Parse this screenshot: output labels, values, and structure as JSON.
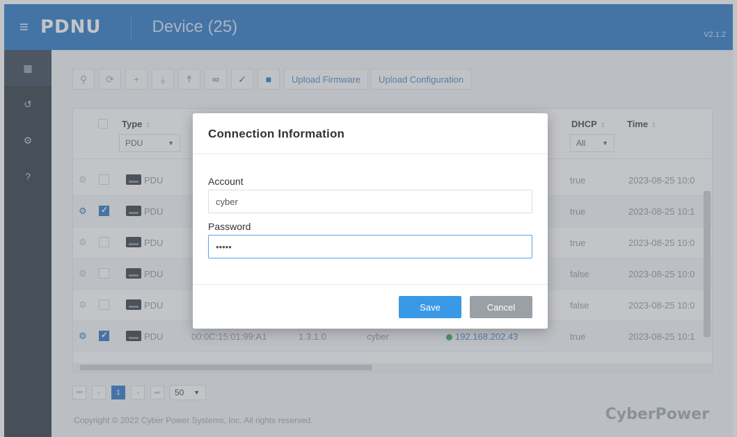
{
  "header": {
    "brand": "PDNU",
    "title": "Device (25)",
    "version": "V2.1.2"
  },
  "sidebar": {
    "items": [
      "grid-icon",
      "history-icon",
      "gear-icon",
      "help-icon"
    ]
  },
  "toolbar": {
    "icons": [
      "search-icon",
      "refresh-icon",
      "add-icon",
      "download-icon",
      "upload-icon",
      "link-icon",
      "check-icon",
      "delete-icon"
    ],
    "upload_firmware": "Upload Firmware",
    "upload_configuration": "Upload Configuration"
  },
  "table": {
    "columns": {
      "type": "Type",
      "dhcp": "DHCP",
      "time": "Time"
    },
    "filters": {
      "type": "PDU",
      "dhcp": "All"
    },
    "rows": [
      {
        "selected": false,
        "type": "PDU",
        "mac": "",
        "fw": "",
        "account": "",
        "ip": "",
        "dhcp": "true",
        "time": "2023-08-25 10:0"
      },
      {
        "selected": true,
        "type": "PDU",
        "mac": "",
        "fw": "",
        "account": "",
        "ip": "",
        "dhcp": "true",
        "time": "2023-08-25 10:1"
      },
      {
        "selected": false,
        "type": "PDU",
        "mac": "",
        "fw": "",
        "account": "",
        "ip": "",
        "dhcp": "true",
        "time": "2023-08-25 10:0"
      },
      {
        "selected": false,
        "type": "PDU",
        "mac": "",
        "fw": "",
        "account": "",
        "ip": "",
        "dhcp": "false",
        "time": "2023-08-25 10:0"
      },
      {
        "selected": false,
        "type": "PDU",
        "mac": "",
        "fw": "",
        "account": "",
        "ip": "",
        "dhcp": "false",
        "time": "2023-08-25 10:0"
      },
      {
        "selected": true,
        "type": "PDU",
        "mac": "00:0C:15:01:99:A1",
        "fw": "1.3.1.0",
        "account": "cyber",
        "ip": "192.168.202.43",
        "dhcp": "true",
        "time": "2023-08-25 10:1"
      }
    ]
  },
  "pager": {
    "first": "⏮",
    "prev": "‹",
    "current": "1",
    "next": "›",
    "last": "⏭",
    "page_size": "50"
  },
  "footer": {
    "copyright": "Copyright © 2022 Cyber Power Systems, Inc. All rights reserved.",
    "logo": "CyberPower"
  },
  "modal": {
    "title": "Connection Information",
    "account_label": "Account",
    "account_value": "cyber",
    "password_label": "Password",
    "password_value": "•••••",
    "save": "Save",
    "cancel": "Cancel"
  },
  "colors": {
    "accent": "#1a6ec2",
    "sidebar": "#1f2b38",
    "save": "#3a99e6",
    "cancel": "#9aa0a6"
  }
}
